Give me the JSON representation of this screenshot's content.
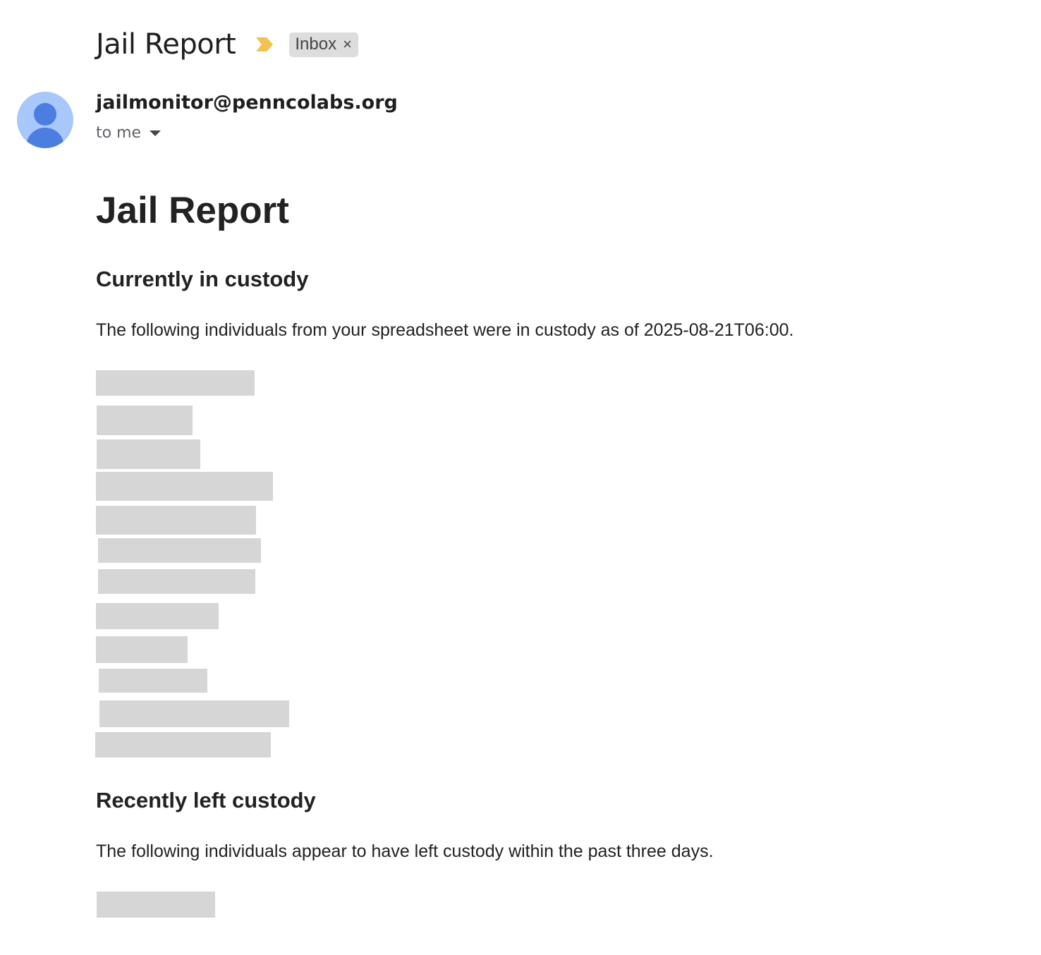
{
  "email": {
    "subject": "Jail Report",
    "label_chip": "Inbox",
    "label_remove_glyph": "×",
    "importance_icon": "importance-marker-icon",
    "importance_color": "#f2c14e",
    "sender": "jailmonitor@penncolabs.org",
    "recipient": "to me",
    "avatar_colors": {
      "background": "#a8c7fa",
      "figure": "#4c7ee1"
    }
  },
  "body": {
    "title": "Jail Report",
    "current_section": {
      "heading": "Currently in custody",
      "text": "The following individuals from your spreadsheet were in custody as of 2025-08-21T06:00.",
      "redacted_entries": 12
    },
    "recent_section": {
      "heading": "Recently left custody",
      "text": "The following individuals appear to have left custody within the past three days.",
      "redacted_entries": 1
    }
  }
}
